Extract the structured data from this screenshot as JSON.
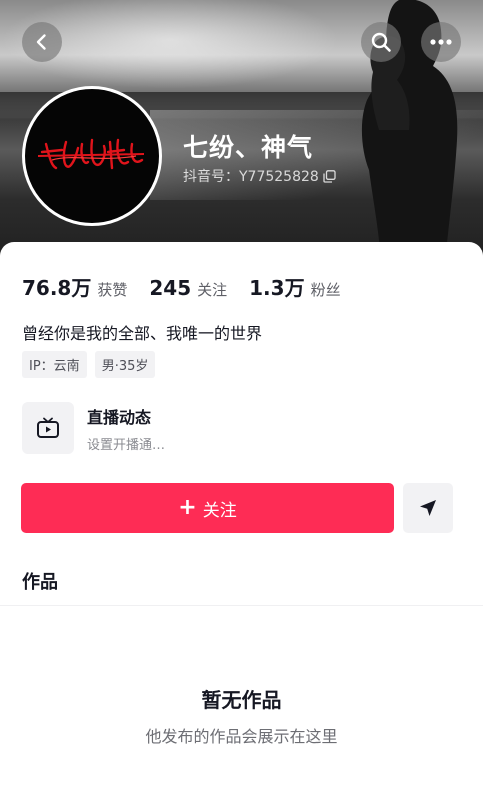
{
  "header": {
    "back_icon": "chevron-left-icon",
    "search_icon": "search-icon",
    "more_icon": "more-dots-icon"
  },
  "profile": {
    "nickname": "七纷、神气",
    "douyin_id": "抖音号：Y77525828",
    "copy_icon": "copy-icon",
    "avatar_text": "七纷神气",
    "avatar_colors": {
      "background": "#050505",
      "text": "#e0141b"
    }
  },
  "stats": [
    {
      "value": "76.8万",
      "label": "获赞"
    },
    {
      "value": "245",
      "label": "关注"
    },
    {
      "value": "1.3万",
      "label": "粉丝"
    }
  ],
  "signature": "曾经你是我的全部、我唯一的世界",
  "tags": [
    "IP：云南",
    "男·35岁"
  ],
  "live": {
    "icon": "tv-play-icon",
    "title": "直播动态",
    "subtitle": "设置开播通…"
  },
  "actions": {
    "follow_label": "关注",
    "follow_plus": "+",
    "message_icon": "send-icon",
    "accent": "#fe2c55"
  },
  "works": {
    "tab_label": "作品",
    "empty_title": "暂无作品",
    "empty_subtitle": "他发布的作品会展示在这里"
  }
}
